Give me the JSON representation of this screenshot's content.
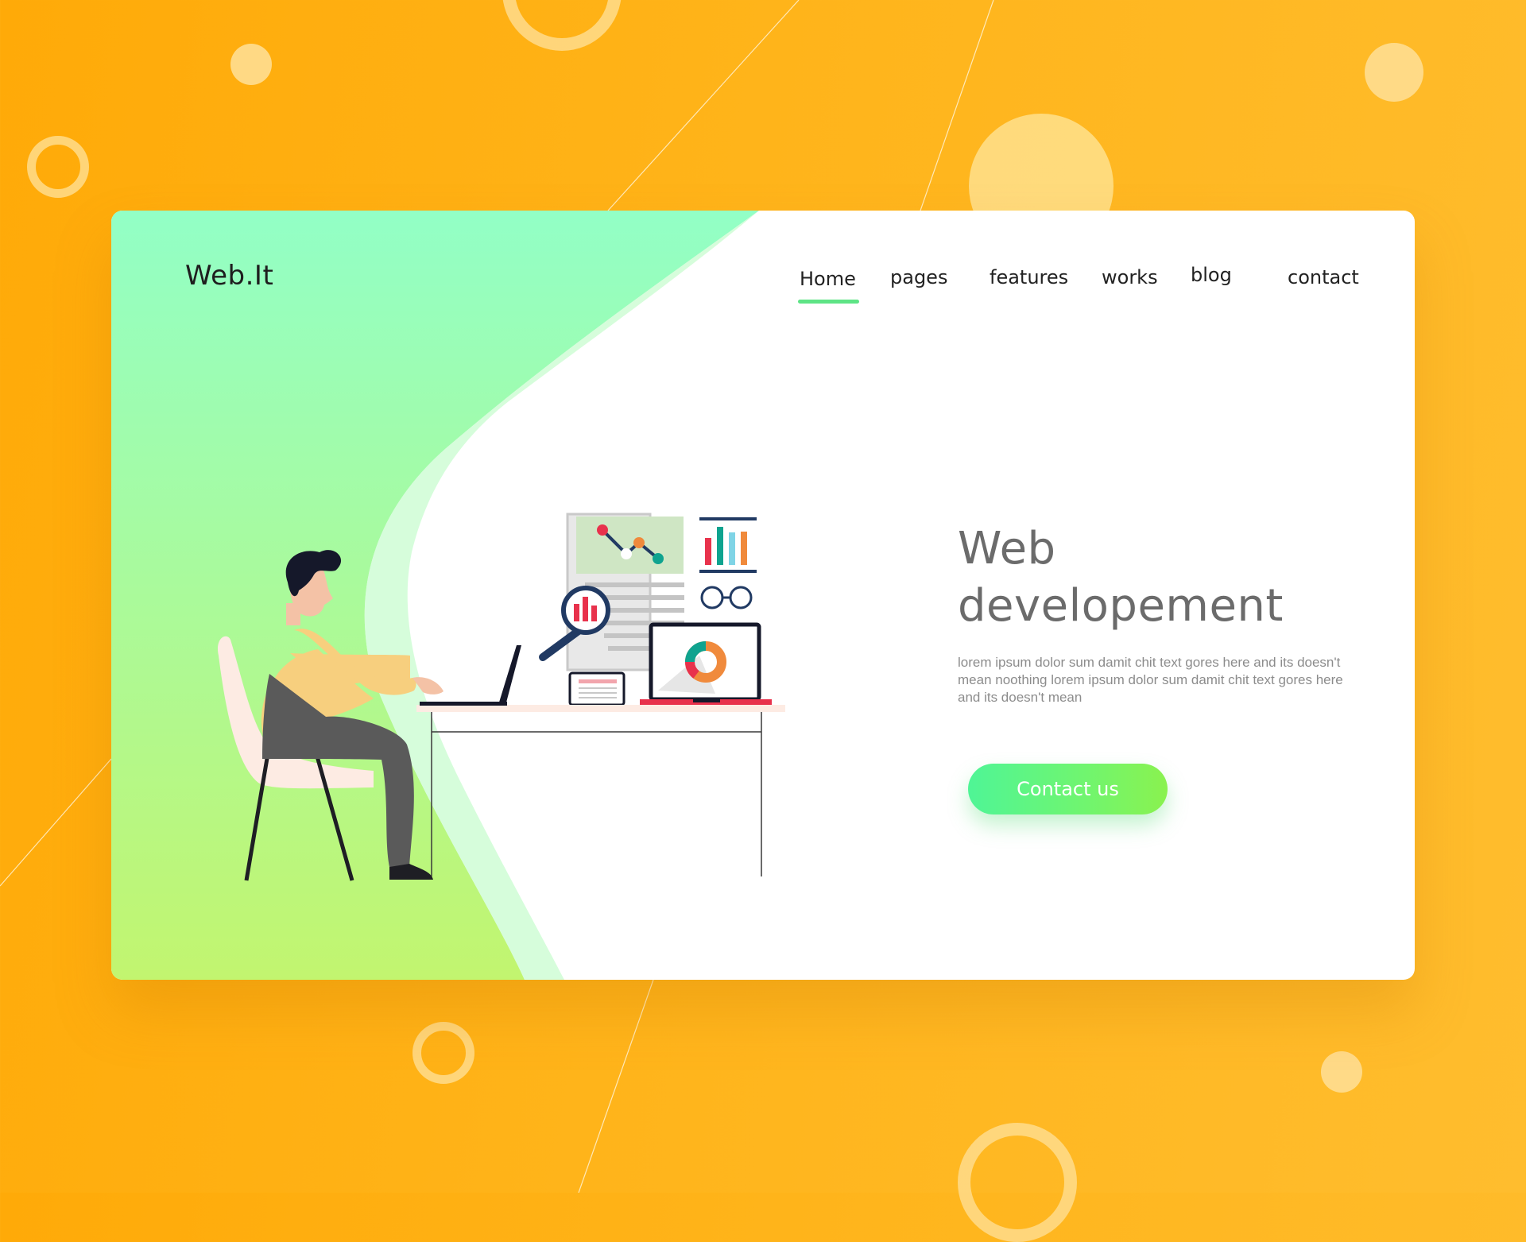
{
  "brand": {
    "logo_text": "Web.It"
  },
  "nav": {
    "items": [
      {
        "label": "Home",
        "active": true
      },
      {
        "label": "pages",
        "active": false
      },
      {
        "label": "features",
        "active": false
      },
      {
        "label": "works",
        "active": false
      },
      {
        "label": "blog",
        "active": false
      },
      {
        "label": "contact",
        "active": false
      }
    ]
  },
  "hero": {
    "title_line1": "Web",
    "title_line2": "developement",
    "description": "lorem ipsum dolor sum damit chit text gores here and its doesn't mean noothing lorem ipsum dolor sum damit chit text gores here and its doesn't mean",
    "cta_label": "Contact us"
  },
  "illustration": {
    "subject": "person-working-at-laptop",
    "icons": [
      "line-chart-icon",
      "bar-chart-icon",
      "magnifier-icon",
      "glasses-icon",
      "donut-chart-icon",
      "tablet-icon",
      "laptop-icon"
    ]
  },
  "colors": {
    "background": "#ffb015",
    "accent_green": "#5ee486",
    "panel_green_top": "#92ffc6",
    "panel_green_bottom": "#c2f56f",
    "text_heading": "#6b6b6b",
    "text_body": "#8c8c8c",
    "white": "#ffffff"
  }
}
